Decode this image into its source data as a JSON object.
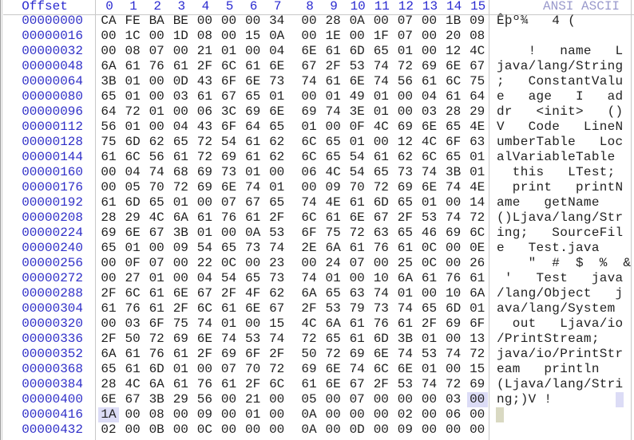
{
  "header": {
    "offset_label": "Offset",
    "columns": [
      "0",
      "1",
      "2",
      "3",
      "4",
      "5",
      "6",
      "7",
      "8",
      "9",
      "10",
      "11",
      "12",
      "13",
      "14",
      "15"
    ],
    "ascii_label": "ANSI ASCII"
  },
  "colors": {
    "offset": "#3030c8",
    "header": "#2a2ad0",
    "ascii_header": "#9a9acc",
    "selection": "#dcdcf6",
    "cursor": "#d9d9c2"
  },
  "selection": {
    "row_offset": "00000400",
    "byte_index": 15
  },
  "cursor": {
    "row_offset": "00000416",
    "byte_index": 0
  },
  "rows": [
    {
      "offset": "00000000",
      "bytes": [
        "CA",
        "FE",
        "BA",
        "BE",
        "00",
        "00",
        "00",
        "34",
        "00",
        "28",
        "0A",
        "00",
        "07",
        "00",
        "1B",
        "09"
      ],
      "ascii": "Êþº¾   4 (      "
    },
    {
      "offset": "00000016",
      "bytes": [
        "00",
        "1C",
        "00",
        "1D",
        "08",
        "00",
        "15",
        "0A",
        "00",
        "1E",
        "00",
        "1F",
        "07",
        "00",
        "20",
        "08"
      ],
      "ascii": "                "
    },
    {
      "offset": "00000032",
      "bytes": [
        "00",
        "08",
        "07",
        "00",
        "21",
        "01",
        "00",
        "04",
        "6E",
        "61",
        "6D",
        "65",
        "01",
        "00",
        "12",
        "4C"
      ],
      "ascii": "    !   name   L"
    },
    {
      "offset": "00000048",
      "bytes": [
        "6A",
        "61",
        "76",
        "61",
        "2F",
        "6C",
        "61",
        "6E",
        "67",
        "2F",
        "53",
        "74",
        "72",
        "69",
        "6E",
        "67"
      ],
      "ascii": "java/lang/String"
    },
    {
      "offset": "00000064",
      "bytes": [
        "3B",
        "01",
        "00",
        "0D",
        "43",
        "6F",
        "6E",
        "73",
        "74",
        "61",
        "6E",
        "74",
        "56",
        "61",
        "6C",
        "75"
      ],
      "ascii": ";   ConstantValu"
    },
    {
      "offset": "00000080",
      "bytes": [
        "65",
        "01",
        "00",
        "03",
        "61",
        "67",
        "65",
        "01",
        "00",
        "01",
        "49",
        "01",
        "00",
        "04",
        "61",
        "64"
      ],
      "ascii": "e   age   I   ad"
    },
    {
      "offset": "00000096",
      "bytes": [
        "64",
        "72",
        "01",
        "00",
        "06",
        "3C",
        "69",
        "6E",
        "69",
        "74",
        "3E",
        "01",
        "00",
        "03",
        "28",
        "29"
      ],
      "ascii": "dr   <init>   ()"
    },
    {
      "offset": "00000112",
      "bytes": [
        "56",
        "01",
        "00",
        "04",
        "43",
        "6F",
        "64",
        "65",
        "01",
        "00",
        "0F",
        "4C",
        "69",
        "6E",
        "65",
        "4E"
      ],
      "ascii": "V   Code   LineN"
    },
    {
      "offset": "00000128",
      "bytes": [
        "75",
        "6D",
        "62",
        "65",
        "72",
        "54",
        "61",
        "62",
        "6C",
        "65",
        "01",
        "00",
        "12",
        "4C",
        "6F",
        "63"
      ],
      "ascii": "umberTable   Loc"
    },
    {
      "offset": "00000144",
      "bytes": [
        "61",
        "6C",
        "56",
        "61",
        "72",
        "69",
        "61",
        "62",
        "6C",
        "65",
        "54",
        "61",
        "62",
        "6C",
        "65",
        "01"
      ],
      "ascii": "alVariableTable "
    },
    {
      "offset": "00000160",
      "bytes": [
        "00",
        "04",
        "74",
        "68",
        "69",
        "73",
        "01",
        "00",
        "06",
        "4C",
        "54",
        "65",
        "73",
        "74",
        "3B",
        "01"
      ],
      "ascii": "  this   LTest; "
    },
    {
      "offset": "00000176",
      "bytes": [
        "00",
        "05",
        "70",
        "72",
        "69",
        "6E",
        "74",
        "01",
        "00",
        "09",
        "70",
        "72",
        "69",
        "6E",
        "74",
        "4E"
      ],
      "ascii": "  print   printN"
    },
    {
      "offset": "00000192",
      "bytes": [
        "61",
        "6D",
        "65",
        "01",
        "00",
        "07",
        "67",
        "65",
        "74",
        "4E",
        "61",
        "6D",
        "65",
        "01",
        "00",
        "14"
      ],
      "ascii": "ame   getName   "
    },
    {
      "offset": "00000208",
      "bytes": [
        "28",
        "29",
        "4C",
        "6A",
        "61",
        "76",
        "61",
        "2F",
        "6C",
        "61",
        "6E",
        "67",
        "2F",
        "53",
        "74",
        "72"
      ],
      "ascii": "()Ljava/lang/Str"
    },
    {
      "offset": "00000224",
      "bytes": [
        "69",
        "6E",
        "67",
        "3B",
        "01",
        "00",
        "0A",
        "53",
        "6F",
        "75",
        "72",
        "63",
        "65",
        "46",
        "69",
        "6C"
      ],
      "ascii": "ing;   SourceFil"
    },
    {
      "offset": "00000240",
      "bytes": [
        "65",
        "01",
        "00",
        "09",
        "54",
        "65",
        "73",
        "74",
        "2E",
        "6A",
        "61",
        "76",
        "61",
        "0C",
        "00",
        "0E"
      ],
      "ascii": "e   Test.java   "
    },
    {
      "offset": "00000256",
      "bytes": [
        "00",
        "0F",
        "07",
        "00",
        "22",
        "0C",
        "00",
        "23",
        "00",
        "24",
        "07",
        "00",
        "25",
        "0C",
        "00",
        "26"
      ],
      "ascii": "    \"  #  $  %  &"
    },
    {
      "offset": "00000272",
      "bytes": [
        "00",
        "27",
        "01",
        "00",
        "04",
        "54",
        "65",
        "73",
        "74",
        "01",
        "00",
        "10",
        "6A",
        "61",
        "76",
        "61"
      ],
      "ascii": " '   Test   java"
    },
    {
      "offset": "00000288",
      "bytes": [
        "2F",
        "6C",
        "61",
        "6E",
        "67",
        "2F",
        "4F",
        "62",
        "6A",
        "65",
        "63",
        "74",
        "01",
        "00",
        "10",
        "6A"
      ],
      "ascii": "/lang/Object   j"
    },
    {
      "offset": "00000304",
      "bytes": [
        "61",
        "76",
        "61",
        "2F",
        "6C",
        "61",
        "6E",
        "67",
        "2F",
        "53",
        "79",
        "73",
        "74",
        "65",
        "6D",
        "01"
      ],
      "ascii": "ava/lang/System "
    },
    {
      "offset": "00000320",
      "bytes": [
        "00",
        "03",
        "6F",
        "75",
        "74",
        "01",
        "00",
        "15",
        "4C",
        "6A",
        "61",
        "76",
        "61",
        "2F",
        "69",
        "6F"
      ],
      "ascii": "  out   Ljava/io"
    },
    {
      "offset": "00000336",
      "bytes": [
        "2F",
        "50",
        "72",
        "69",
        "6E",
        "74",
        "53",
        "74",
        "72",
        "65",
        "61",
        "6D",
        "3B",
        "01",
        "00",
        "13"
      ],
      "ascii": "/PrintStream;   "
    },
    {
      "offset": "00000352",
      "bytes": [
        "6A",
        "61",
        "76",
        "61",
        "2F",
        "69",
        "6F",
        "2F",
        "50",
        "72",
        "69",
        "6E",
        "74",
        "53",
        "74",
        "72"
      ],
      "ascii": "java/io/PrintStr"
    },
    {
      "offset": "00000368",
      "bytes": [
        "65",
        "61",
        "6D",
        "01",
        "00",
        "07",
        "70",
        "72",
        "69",
        "6E",
        "74",
        "6C",
        "6E",
        "01",
        "00",
        "15"
      ],
      "ascii": "eam   println   "
    },
    {
      "offset": "00000384",
      "bytes": [
        "28",
        "4C",
        "6A",
        "61",
        "76",
        "61",
        "2F",
        "6C",
        "61",
        "6E",
        "67",
        "2F",
        "53",
        "74",
        "72",
        "69"
      ],
      "ascii": "(Ljava/lang/Stri"
    },
    {
      "offset": "00000400",
      "bytes": [
        "6E",
        "67",
        "3B",
        "29",
        "56",
        "00",
        "21",
        "00",
        "05",
        "00",
        "07",
        "00",
        "00",
        "00",
        "03",
        "00"
      ],
      "ascii": "ng;)V !         "
    },
    {
      "offset": "00000416",
      "bytes": [
        "1A",
        "00",
        "08",
        "00",
        "09",
        "00",
        "01",
        "00",
        "0A",
        "00",
        "00",
        "00",
        "02",
        "00",
        "06",
        "00"
      ],
      "ascii": "                "
    },
    {
      "offset": "00000432",
      "bytes": [
        "02",
        "00",
        "0B",
        "00",
        "0C",
        "00",
        "00",
        "00",
        "0A",
        "00",
        "0D",
        "00",
        "09",
        "00",
        "00",
        "00"
      ],
      "ascii": "                "
    }
  ]
}
